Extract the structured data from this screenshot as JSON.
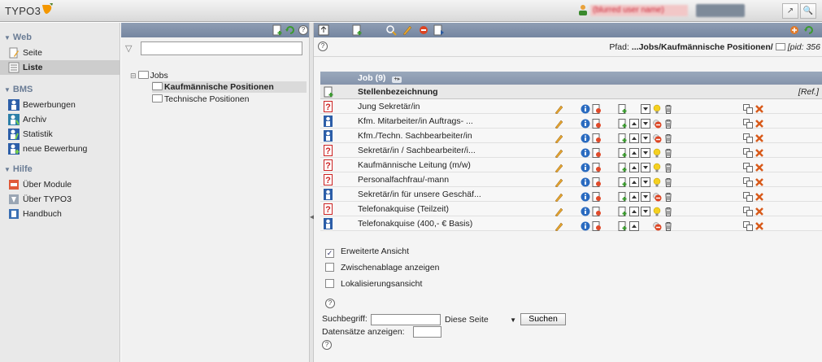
{
  "topbar": {
    "logo_text": "TYPO3",
    "user_label": "(blurred user name)",
    "colors": {
      "accent": "#f49700"
    }
  },
  "module_menu": {
    "groups": [
      {
        "label": "Web",
        "items": [
          {
            "label": "Seite",
            "icon": "page-edit-icon"
          },
          {
            "label": "Liste",
            "icon": "list-icon",
            "active": true
          }
        ]
      },
      {
        "label": "BMS",
        "items": [
          {
            "label": "Bewerbungen",
            "icon": "person-blue-icon"
          },
          {
            "label": "Archiv",
            "icon": "archive-icon"
          },
          {
            "label": "Statistik",
            "icon": "statistics-icon"
          },
          {
            "label": "neue Bewerbung",
            "icon": "person-add-icon"
          }
        ]
      },
      {
        "label": "Hilfe",
        "items": [
          {
            "label": "Über Module",
            "icon": "about-modules-icon"
          },
          {
            "label": "Über TYPO3",
            "icon": "about-typo3-icon"
          },
          {
            "label": "Handbuch",
            "icon": "manual-icon"
          }
        ]
      }
    ]
  },
  "page_tree": {
    "filter_placeholder": "",
    "root": "Jobs",
    "children": [
      "Kaufmännische Positionen",
      "Technische Positionen"
    ],
    "selected": "Kaufmännische Positionen"
  },
  "content": {
    "path_label": "Pfad:",
    "path_value": "...Jobs/Kaufmännische Positionen/",
    "pid_text": "[pid: 356",
    "list_title": "Job (9)",
    "column_title": "Stellenbezeichnung",
    "ref_label": "[Ref.]",
    "rows": [
      {
        "title": "Jung Sekretär/in",
        "type": "unknown",
        "status": "bulb"
      },
      {
        "title": "Kfm. Mitarbeiter/in Auftrags- ...",
        "type": "person",
        "status": "hide"
      },
      {
        "title": "Kfm./Techn. Sachbearbeiter/in",
        "type": "person",
        "status": "hide"
      },
      {
        "title": "Sekretär/in / Sachbearbeiter/i...",
        "type": "unknown",
        "status": "bulb"
      },
      {
        "title": "Kaufmännische Leitung (m/w)",
        "type": "unknown",
        "status": "bulb"
      },
      {
        "title": "Personalfachfrau/-mann",
        "type": "unknown",
        "status": "bulb"
      },
      {
        "title": "Sekretär/in für unsere Geschäf...",
        "type": "person",
        "status": "hide"
      },
      {
        "title": "Telefonakquise (Teilzeit)",
        "type": "unknown",
        "status": "bulb"
      },
      {
        "title": "Telefonakquise (400,- € Basis)",
        "type": "person",
        "status": "hide"
      }
    ],
    "options": [
      {
        "label": "Erweiterte Ansicht",
        "checked": true
      },
      {
        "label": "Zwischenablage anzeigen",
        "checked": false
      },
      {
        "label": "Lokalisierungsansicht",
        "checked": false
      }
    ],
    "search": {
      "label": "Suchbegriff:",
      "value": "",
      "scope": "Diese Seite",
      "button": "Suchen",
      "count_label": "Datensätze anzeigen:",
      "count_value": ""
    }
  }
}
